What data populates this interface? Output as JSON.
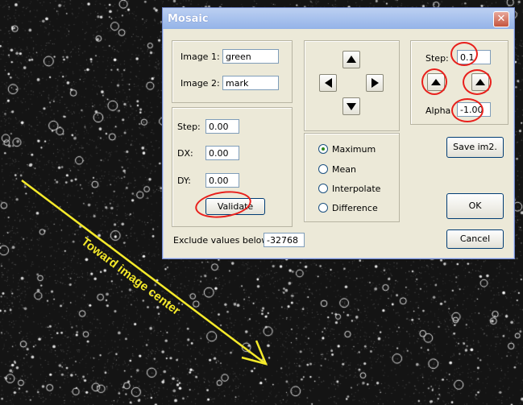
{
  "window": {
    "title": "Mosaic",
    "close_symbol": "✕"
  },
  "images": {
    "image1_label": "Image 1:",
    "image1_value": "green",
    "image2_label": "Image 2:",
    "image2_value": "mark"
  },
  "offset": {
    "step_label": "Step:",
    "step_value": "0.00",
    "dx_label": "DX:",
    "dx_value": "0.00",
    "dy_label": "DY:",
    "dy_value": "0.00",
    "validate_label": "Validate"
  },
  "blend_modes": {
    "options": [
      "Maximum",
      "Mean",
      "Interpolate",
      "Difference"
    ],
    "selected": "Maximum"
  },
  "rotation": {
    "step_label": "Step:",
    "step_value": "0.1",
    "alpha_label": "Alpha",
    "alpha_value": "-1.00"
  },
  "buttons": {
    "save_label": "Save im2.",
    "ok_label": "OK",
    "cancel_label": "Cancel"
  },
  "exclude": {
    "label": "Exclude values below:",
    "value": "-32768"
  },
  "annotation": {
    "text": "Toward image center",
    "color": "#f5ea2a",
    "marks_color": "#e8201c"
  }
}
